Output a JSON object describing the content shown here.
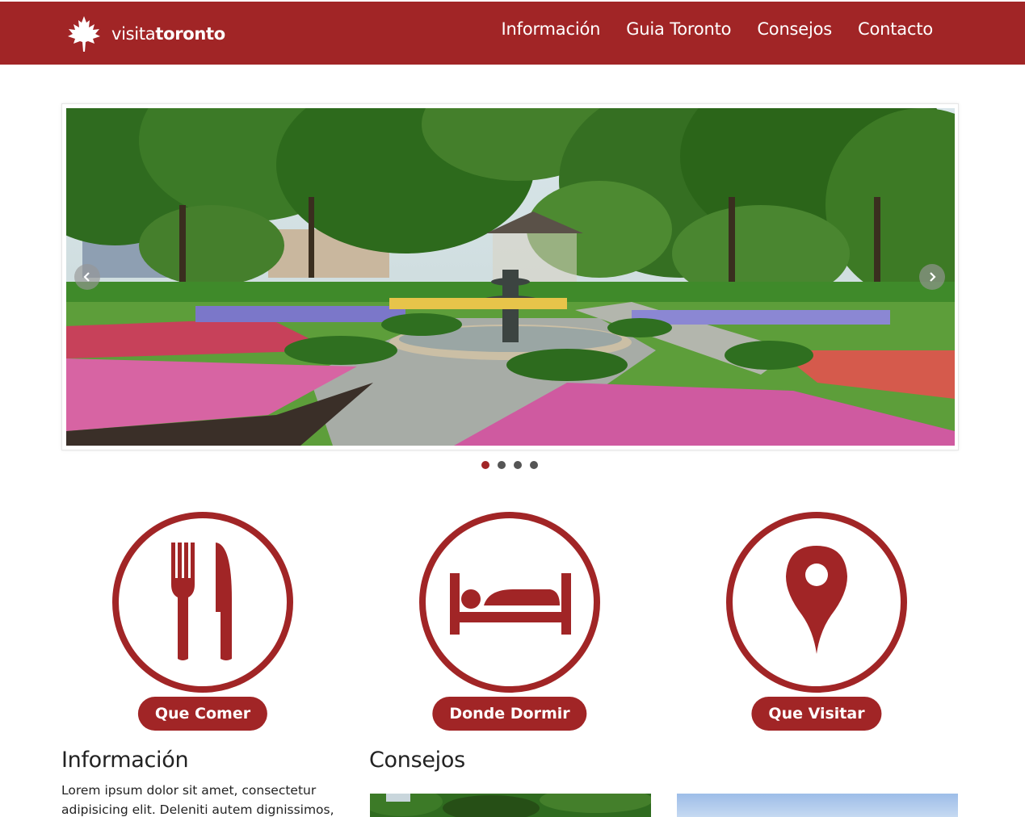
{
  "header": {
    "logo_light": "visita",
    "logo_bold": "toronto",
    "nav": [
      {
        "label": "Información"
      },
      {
        "label": "Guia Toronto"
      },
      {
        "label": "Consejos"
      },
      {
        "label": "Contacto"
      }
    ]
  },
  "carousel": {
    "slide_count": 4,
    "active_index": 0
  },
  "features": [
    {
      "label": "Que Comer",
      "icon": "utensils-icon"
    },
    {
      "label": "Donde Dormir",
      "icon": "bed-icon"
    },
    {
      "label": "Que Visitar",
      "icon": "map-pin-icon"
    }
  ],
  "info": {
    "title": "Información",
    "text": "Lorem ipsum dolor sit amet, consectetur adipisicing elit. Deleniti autem dignissimos,"
  },
  "tips": {
    "title": "Consejos"
  },
  "colors": {
    "brand": "#a12526",
    "white": "#ffffff"
  }
}
